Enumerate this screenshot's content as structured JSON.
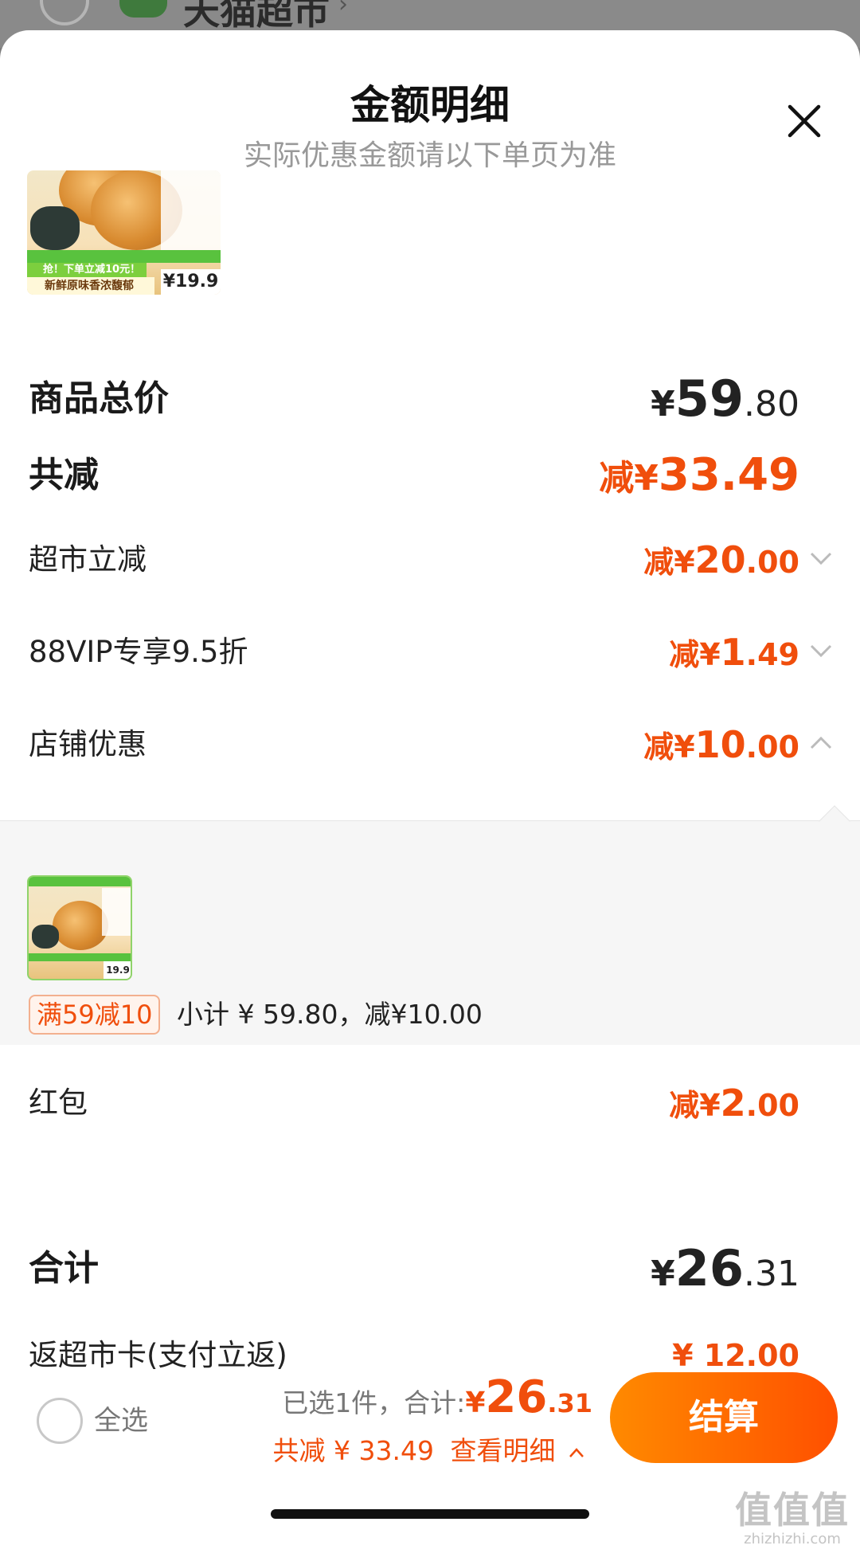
{
  "background": {
    "store_name": "天猫超市",
    "logo_color": "#3f7a3d"
  },
  "sheet": {
    "title": "金额明细",
    "subtitle": "实际优惠金额请以下单页为准",
    "close_icon": "close-icon"
  },
  "product_thumb": {
    "promo_banner": "抢！下单立减10元！",
    "slogan": "新鲜原味香浓馥郁",
    "price": "¥19.9"
  },
  "summary": {
    "total_label": "商品总价",
    "total_symbol": "¥",
    "total_int": "59",
    "total_dec": ".80",
    "discount_label": "共减",
    "discount_prefix": "减¥",
    "discount_value": "33.49"
  },
  "discounts": [
    {
      "label": "超市立减",
      "prefix": "减¥",
      "int": "20",
      "dec": ".00",
      "chevron": "chevron-down-icon"
    },
    {
      "label": "88VIP专享9.5折",
      "prefix": "减¥",
      "int": "1",
      "dec": ".49",
      "chevron": "chevron-down-icon"
    },
    {
      "label": "店铺优惠",
      "prefix": "减¥",
      "int": "10",
      "dec": ".00",
      "chevron": "chevron-up-icon"
    }
  ],
  "store_detail": {
    "tag": "满59减10",
    "subtotal_text": "小计 ¥ 59.80，减¥10.00",
    "thumb_price": "19.9"
  },
  "red_packet": {
    "label": "红包",
    "prefix": "减¥",
    "int": "2",
    "dec": ".00"
  },
  "grand_total": {
    "label": "合计",
    "symbol": "¥",
    "int": "26",
    "dec": ".31"
  },
  "card_rebate": {
    "label": "返超市卡(支付立返)",
    "value": "¥ 12.00"
  },
  "bottom_bar": {
    "select_all": "全选",
    "selected_prefix": "已选1件，合计:",
    "amount_symbol": "¥",
    "amount_int": "26",
    "amount_dec": ".31",
    "saved_text": "共减 ¥ 33.49",
    "view_details": "查看明细",
    "checkout_label": "结算",
    "accent_color": "#ff5000"
  },
  "watermark": {
    "line1": "值值值",
    "line2": "zhizhizhi.com"
  }
}
